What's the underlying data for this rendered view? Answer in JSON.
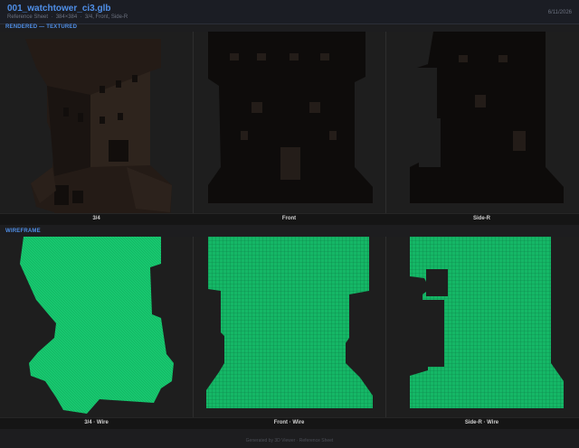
{
  "header": {
    "title": "001_watchtower_ci3.glb",
    "subtitle": "Reference Sheet  ·  384×384  ·  3/4, Front, Side-R",
    "date": "6/11/2026"
  },
  "sections": {
    "rendered": "RENDERED — TEXTURED",
    "wireframe": "WIREFRAME"
  },
  "rendered_views": [
    {
      "caption": "3/4"
    },
    {
      "caption": "Front"
    },
    {
      "caption": "Side-R"
    }
  ],
  "wire_views": [
    {
      "caption": "3/4  ·  Wire"
    },
    {
      "caption": "Front  ·  Wire"
    },
    {
      "caption": "Side-R  ·  Wire"
    }
  ],
  "footer": {
    "text": "Generated by 3D Viewer · Reference Sheet"
  },
  "colors": {
    "accent": "#4f8fe8",
    "wire": "#17c86f",
    "render_dark": "#0f0d0c",
    "render_brown": "#2b211b",
    "background": "#1e1e1e"
  }
}
